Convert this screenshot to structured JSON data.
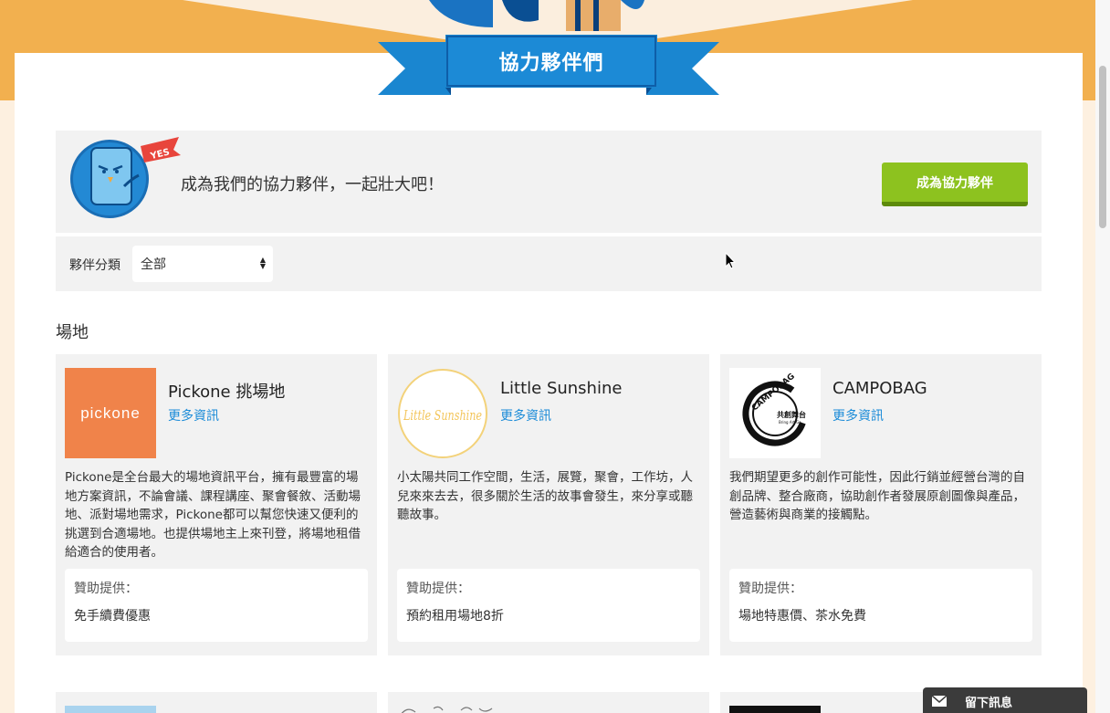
{
  "header": {
    "title": "協力夥伴們"
  },
  "cta": {
    "text": "成為我們的協力夥伴，一起壯大吧！",
    "button_label": "成為協力夥伴",
    "mascot_badge": "YES"
  },
  "filter": {
    "label": "夥伴分類",
    "selected": "全部"
  },
  "section": {
    "title": "場地"
  },
  "partners": [
    {
      "name": "Pickone 挑場地",
      "more_link": "更多資訊",
      "logo_text": "pickone",
      "description": "Pickone是全台最大的場地資訊平台，擁有最豐富的場地方案資訊，不論會議、課程講座、聚會餐敘、活動場地、派對場地需求，Pickone都可以幫您快速又便利的挑選到合適場地。也提供場地主上來刊登，將場地租借給適合的使用者。",
      "sponsor_label": "贊助提供：",
      "sponsor_value": "免手續費優惠"
    },
    {
      "name": "Little Sunshine",
      "more_link": "更多資訊",
      "logo_text": "Little Sunshine",
      "description": "小太陽共同工作空間，生活，展覽，聚會，工作坊，人兒來來去去，很多關於生活的故事會發生，來分享或聽聽故事。",
      "sponsor_label": "贊助提供：",
      "sponsor_value": "預約租用場地8折"
    },
    {
      "name": "CAMPOBAG",
      "more_link": "更多資訊",
      "logo_text": "CAMPOBAG",
      "logo_subtext": "共創舞台",
      "logo_subtext2": "Bring Art Go",
      "description": "我們期望更多的創作可能性，因此行銷並經營台灣的自創品牌、整合廠商，協助創作者發展原創圖像與產品，營造藝術與商業的接觸點。",
      "sponsor_label": "贊助提供：",
      "sponsor_value": "場地特惠價、茶水免費"
    }
  ],
  "widget": {
    "label": "留下訊息",
    "icon": "envelope-icon"
  },
  "colors": {
    "orange_bg": "#f2b04f",
    "ribbon_blue": "#1a86d0",
    "cta_green": "#8dc21f",
    "link_blue": "#1a8bd8",
    "pickone_orange": "#f0834a"
  }
}
